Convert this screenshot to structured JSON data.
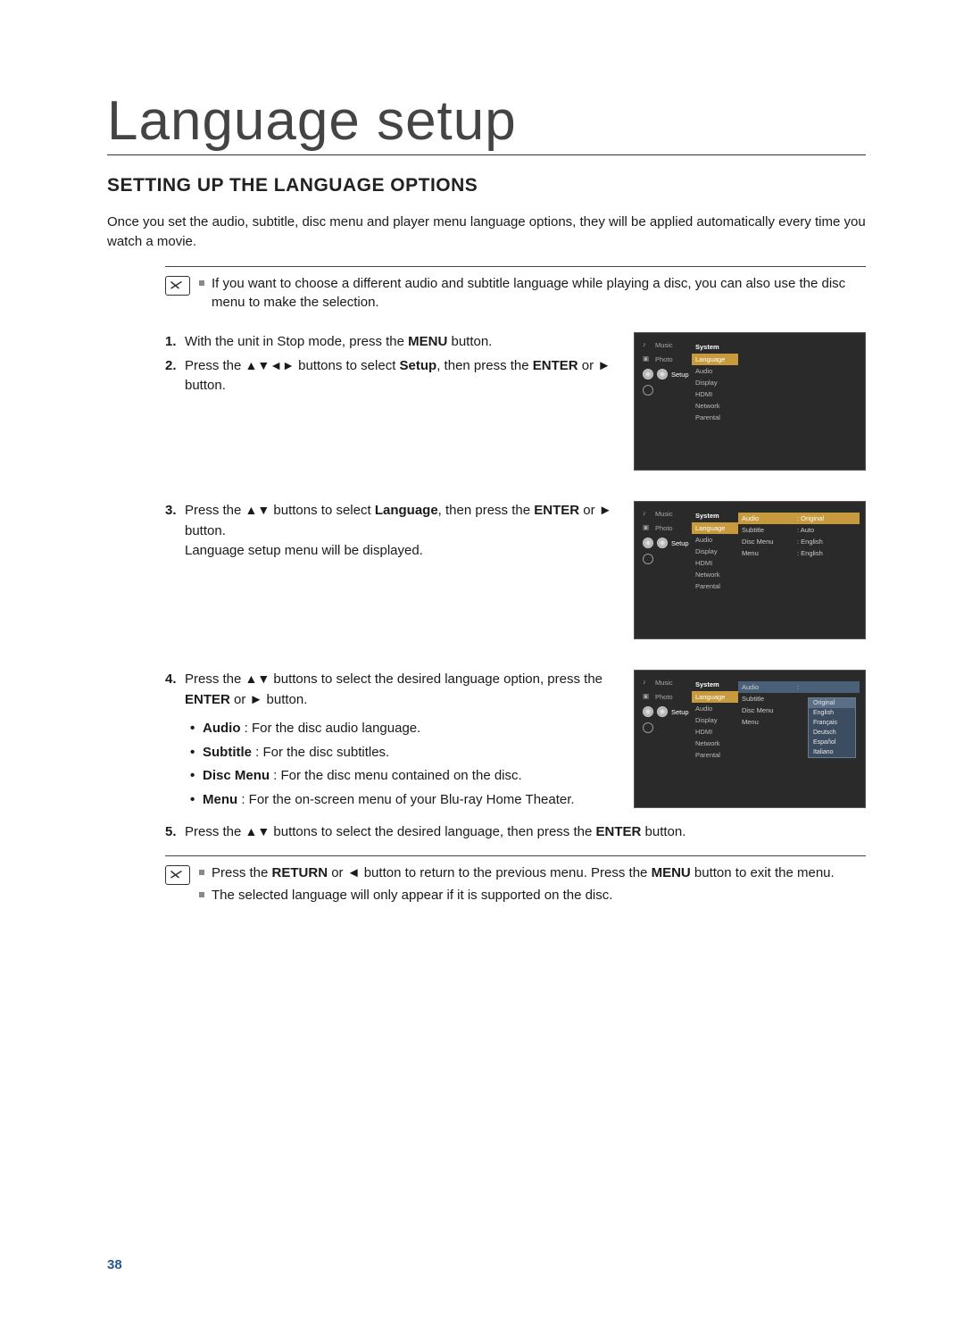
{
  "chapter": "Language setup",
  "section": "SETTING UP THE LANGUAGE OPTIONS",
  "intro": "Once you set the audio, subtitle, disc menu and player menu language options, they will be applied automatically every time you watch a movie.",
  "note1": "If you want to choose a different audio and subtitle language while playing a disc, you can also use the disc menu to make the selection.",
  "steps": {
    "s1_pre": "With the unit in Stop mode, press the ",
    "s1_bold": "MENU",
    "s1_post": " button.",
    "s2_pre": "Press the ",
    "s2_arrows": "▲▼◄►",
    "s2_mid": " buttons to select ",
    "s2_bold": "Setup",
    "s2_post": ", then press the ",
    "s2_bold2": "ENTER",
    "s2_post2": " or ► button.",
    "s3_pre": "Press the ",
    "s3_arrows": "▲▼",
    "s3_mid": " buttons to select ",
    "s3_bold": "Language",
    "s3_post": ", then press the ",
    "s3_bold2": "ENTER",
    "s3_post2": " or ► button.",
    "s3_note": "Language setup menu will be displayed.",
    "s4_pre": "Press the ",
    "s4_arrows": "▲▼",
    "s4_mid": " buttons to select the desired language option, press the ",
    "s4_bold": "ENTER",
    "s4_post": " or ► button.",
    "s4_bullets": {
      "audio_b": "Audio",
      "audio": " : For the disc audio language.",
      "subtitle_b": "Subtitle",
      "subtitle": " : For the disc subtitles.",
      "discmenu_b": "Disc Menu",
      "discmenu": " : For the disc menu contained on the disc.",
      "menu_b": "Menu",
      "menu": " : For the on-screen menu of your Blu-ray Home Theater."
    },
    "s5_pre": "Press the ",
    "s5_arrows": "▲▼",
    "s5_mid": " buttons to select the desired language, then press the ",
    "s5_bold": "ENTER",
    "s5_post": " button."
  },
  "note2a_pre": "Press the ",
  "note2a_b1": "RETURN",
  "note2a_mid": " or ◄ button to return to the previous menu. Press the ",
  "note2a_b2": "MENU",
  "note2a_post": " button to exit the menu.",
  "note2b": "The selected language will only appear if it is supported on the disc.",
  "screens": {
    "sidebar": {
      "music": "Music",
      "photo": "Photo",
      "setup": "Setup"
    },
    "col1": [
      "System",
      "Language",
      "Audio",
      "Display",
      "HDMI",
      "Network",
      "Parental"
    ],
    "col2_s2": [
      "Audio",
      "Subtitle",
      "Disc Menu",
      "Menu"
    ],
    "col2vals_s2": [
      ": Original",
      ": Auto",
      ": English",
      ": English"
    ],
    "dropdown": [
      "Original",
      "English",
      "Français",
      "Deutsch",
      "Español",
      "Italiano"
    ]
  },
  "pageNumber": "38"
}
